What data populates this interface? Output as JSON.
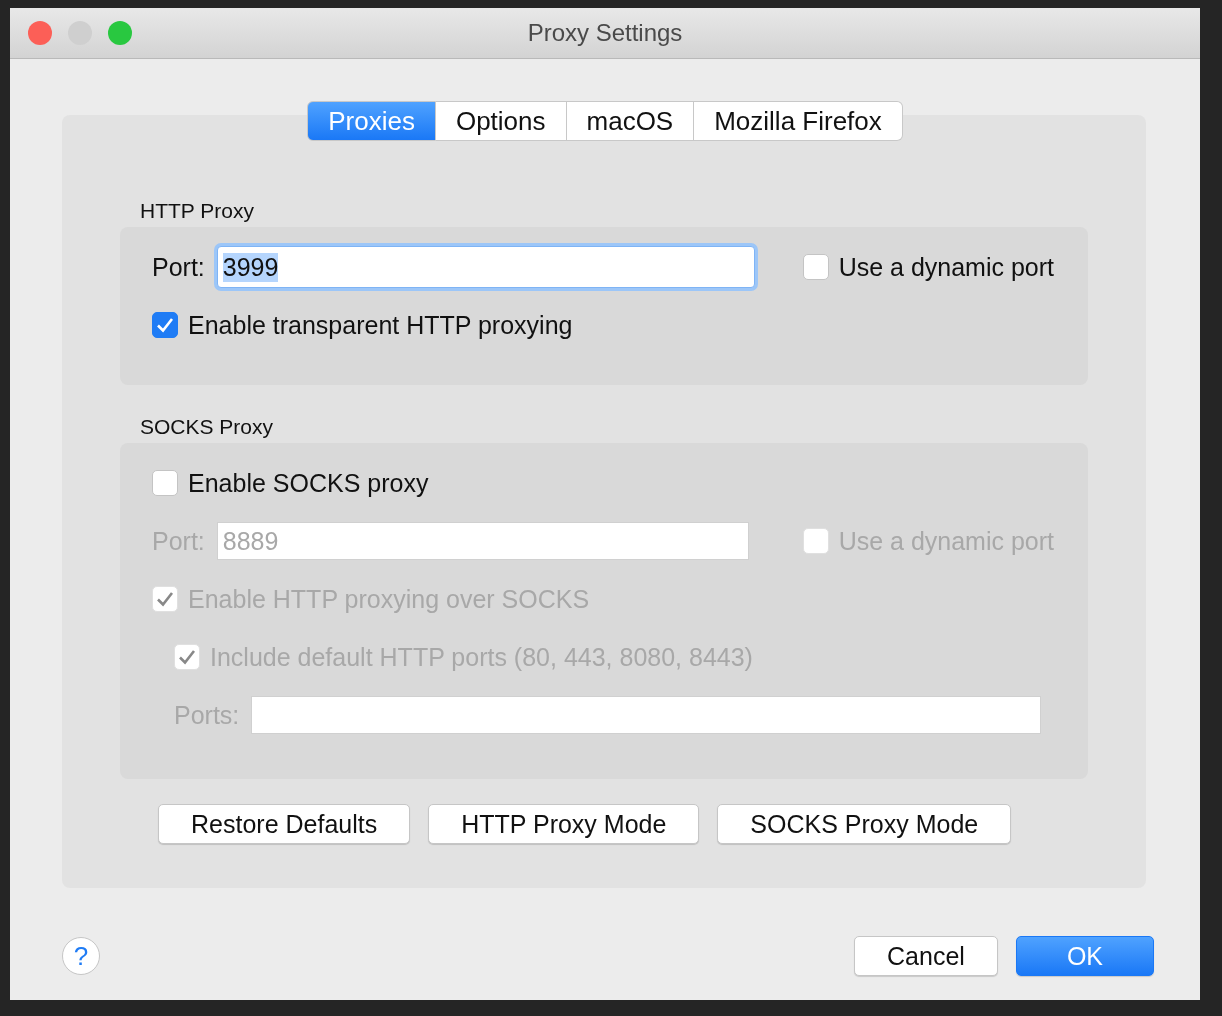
{
  "window": {
    "title": "Proxy Settings"
  },
  "tabs": [
    {
      "label": "Proxies",
      "selected": true
    },
    {
      "label": "Options",
      "selected": false
    },
    {
      "label": "macOS",
      "selected": false
    },
    {
      "label": "Mozilla Firefox",
      "selected": false
    }
  ],
  "http_proxy": {
    "title": "HTTP Proxy",
    "port_label": "Port:",
    "port_value": "3999",
    "options": [
      {
        "label": "Use a dynamic port",
        "checked": false,
        "disabled": false
      },
      {
        "label": "Enable transparent HTTP proxying",
        "checked": true,
        "disabled": false
      }
    ]
  },
  "socks_proxy": {
    "title": "SOCKS Proxy",
    "enable": {
      "label": "Enable SOCKS proxy",
      "checked": false,
      "disabled": false
    },
    "port_label": "Port:",
    "port_value": "8889",
    "port_disabled": true,
    "options": [
      {
        "label": "Use a dynamic port",
        "checked": false,
        "disabled": true
      },
      {
        "label": "Enable HTTP proxying over SOCKS",
        "checked": true,
        "disabled": true
      },
      {
        "label": "Include default HTTP ports (80, 443, 8080, 8443)",
        "checked": true,
        "disabled": true
      }
    ],
    "ports_label": "Ports:"
  },
  "mode_buttons": [
    "Restore Defaults",
    "HTTP Proxy Mode",
    "SOCKS Proxy Mode"
  ],
  "help": "?",
  "dialog_buttons": [
    {
      "label": "Cancel",
      "default": false
    },
    {
      "label": "OK",
      "default": true
    }
  ]
}
